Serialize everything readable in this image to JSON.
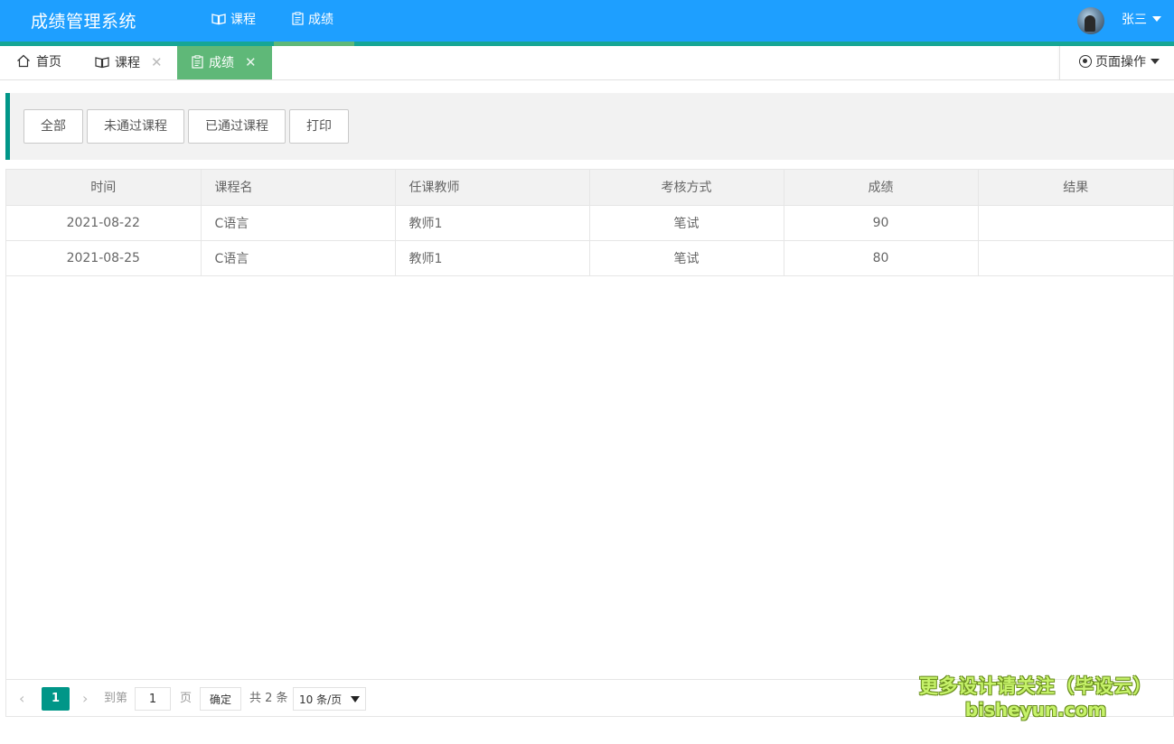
{
  "header": {
    "app_title": "成绩管理系统",
    "nav": [
      {
        "label": "课程",
        "icon": "book-icon"
      },
      {
        "label": "成绩",
        "icon": "clipboard-icon",
        "active": true
      }
    ],
    "user_name": "张三",
    "colors": {
      "bar": "#1e9fff",
      "accent_line": "#16a695",
      "active_nav": "#5fb878"
    }
  },
  "tabs": [
    {
      "label": "首页",
      "icon": "home-icon",
      "closable": false
    },
    {
      "label": "课程",
      "icon": "book-icon",
      "closable": true
    },
    {
      "label": "成绩",
      "icon": "clipboard-icon",
      "closable": true,
      "active": true
    }
  ],
  "tab_close_glyph": "✕",
  "page_ops_label": "页面操作",
  "toolbar": {
    "all": "全部",
    "failed": "未通过课程",
    "passed": "已通过课程",
    "print": "打印"
  },
  "table": {
    "columns": [
      "时间",
      "课程名",
      "任课教师",
      "考核方式",
      "成绩",
      "结果"
    ],
    "rows": [
      {
        "time": "2021-08-22",
        "course": "C语言",
        "teacher": "教师1",
        "method": "笔试",
        "score": "90",
        "result": ""
      },
      {
        "time": "2021-08-25",
        "course": "C语言",
        "teacher": "教师1",
        "method": "笔试",
        "score": "80",
        "result": ""
      }
    ]
  },
  "pager": {
    "prev": "‹",
    "current": "1",
    "next": "›",
    "goto_label": "到第",
    "goto_value": "1",
    "page_label": "页",
    "confirm": "确定",
    "total": "共 2 条",
    "limit": "10 条/页"
  },
  "watermark": {
    "line1": "更多设计请关注（毕设云）",
    "line2": "bisheyun.com"
  }
}
